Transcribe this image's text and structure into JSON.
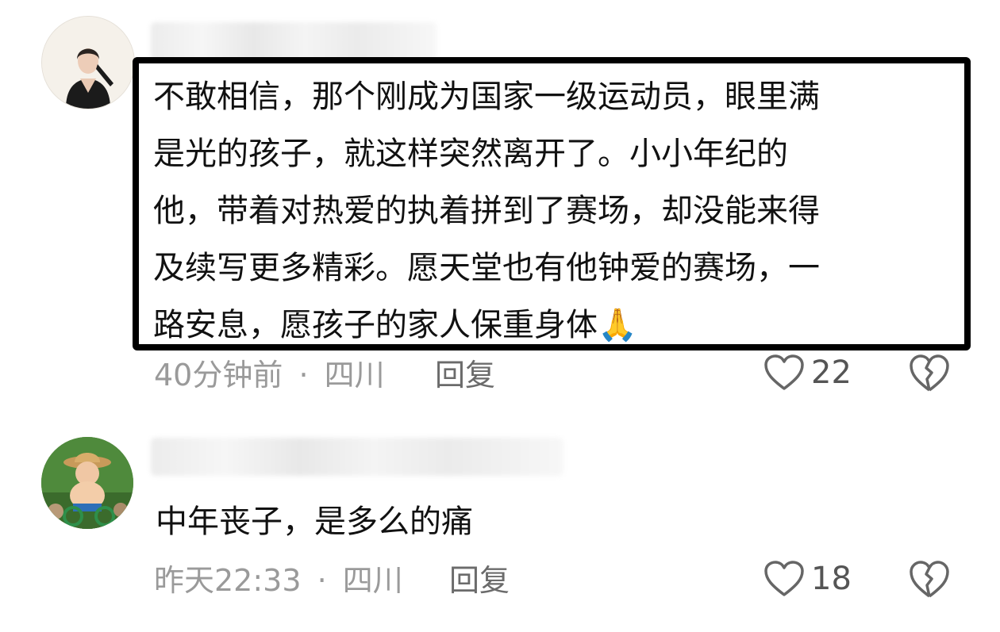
{
  "comments": [
    {
      "text": "不敢相信，那个刚成为国家一级运动员，眼里满\n是光的孩子，就这样突然离开了。小小年纪的\n他，带着对热爱的执着拼到了赛场，却没能来得\n及续写更多精彩。愿天堂也有他钟爱的赛场，一\n路安息，愿孩子的家人保重身体",
      "emoji": "🙏",
      "time": "40分钟前",
      "separator": "·",
      "location": "四川",
      "reply_label": "回复",
      "likes": "22",
      "avatar_icon": "user-avatar-woman-black-dress",
      "highlighted": true
    },
    {
      "text": "中年丧子，是多么的痛",
      "time": "昨天22:33",
      "separator": "·",
      "location": "四川",
      "reply_label": "回复",
      "likes": "18",
      "avatar_icon": "user-avatar-cartoon-baby-on-bike",
      "highlighted": false
    }
  ],
  "colors": {
    "meta": "#9a9a9a",
    "highlight_border": "#000000",
    "icon_stroke": "#666666"
  }
}
